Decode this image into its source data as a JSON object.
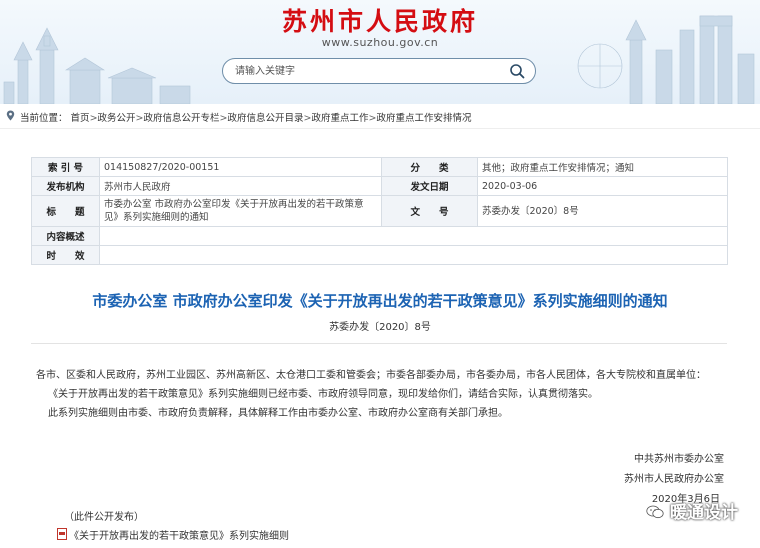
{
  "header": {
    "site_title": "苏州市人民政府",
    "site_url": "www.suzhou.gov.cn",
    "search_placeholder": "请输入关键字"
  },
  "breadcrumb": {
    "label": "当前位置：",
    "items": [
      "首页",
      "政务公开",
      "政府信息公开专栏",
      "政府信息公开目录",
      "政府重点工作",
      "政府重点工作安排情况"
    ],
    "separator": ">"
  },
  "meta_table": {
    "index_label": "索 引 号",
    "index_value": "014150827/2020-00151",
    "category_label": "分　　类",
    "category_value": "其他；政府重点工作安排情况；通知",
    "publisher_label": "发布机构",
    "publisher_value": "苏州市人民政府",
    "date_label": "发文日期",
    "date_value": "2020-03-06",
    "title_label": "标　　题",
    "title_value": "市委办公室 市政府办公室印发《关于开放再出发的若干政策意见》系列实施细则的通知",
    "docno_label": "文　　号",
    "docno_value": "苏委办发〔2020〕8号",
    "summary_label": "内容概述",
    "summary_value": "",
    "validity_label": "时　　效",
    "validity_value": ""
  },
  "document": {
    "title": "市委办公室 市政府办公室印发《关于开放再出发的若干政策意见》系列实施细则的通知",
    "number": "苏委办发〔2020〕8号",
    "paragraphs": [
      "各市、区委和人民政府，苏州工业园区、苏州高新区、太仓港口工委和管委会；市委各部委办局，市各委办局，市各人民团体，各大专院校和直属单位：",
      "《关于开放再出发的若干政策意见》系列实施细则已经市委、市政府领导同意，现印发给你们，请结合实际，认真贯彻落实。",
      "此系列实施细则由市委、市政府负责解释，具体解释工作由市委办公室、市政府办公室商有关部门承担。"
    ],
    "signatory_1": "中共苏州市委办公室",
    "signatory_2": "苏州市人民政府办公室",
    "sign_date": "2020年3月6日",
    "publish_note": "（此件公开发布）",
    "attachment": "《关于开放再出发的若干政策意见》系列实施细则"
  },
  "watermark": "暖通设计",
  "colors": {
    "site_title": "#d40d12",
    "doc_title": "#1c63b3",
    "table_key_bg": "#f1f4f8",
    "table_border": "#d7dde4"
  }
}
